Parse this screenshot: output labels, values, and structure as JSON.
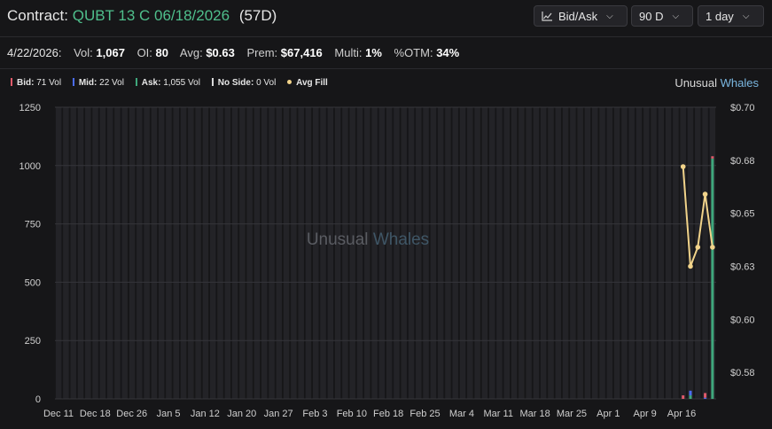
{
  "header": {
    "contract_prefix": "Contract:",
    "contract_name": "QUBT 13 C 06/18/2026",
    "dte": "(57D)",
    "view_label": "Bid/Ask",
    "range_label": "90 D",
    "interval_label": "1 day"
  },
  "stats": {
    "date": "4/22/2026:",
    "vol_label": "Vol:",
    "vol": "1,067",
    "oi_label": "OI:",
    "oi": "80",
    "avg_label": "Avg:",
    "avg": "$0.63",
    "prem_label": "Prem:",
    "prem": "$67,416",
    "multi_label": "Multi:",
    "multi": "1%",
    "otm_label": "%OTM:",
    "otm": "34%"
  },
  "legend": {
    "bid_label": "Bid:",
    "bid_value": "71 Vol",
    "mid_label": "Mid:",
    "mid_value": "22 Vol",
    "ask_label": "Ask:",
    "ask_value": "1,055 Vol",
    "noside_label": "No Side:",
    "noside_value": "0 Vol",
    "avgfill_label": "Avg Fill"
  },
  "brand": {
    "word1": "Unusual",
    "word2": "Whales"
  },
  "colors": {
    "bid": "#e05a6a",
    "mid": "#4a6cf0",
    "ask": "#3fa77c",
    "noside": "#d9d9d9",
    "avgfill": "#f1d38a",
    "background": "#161618"
  },
  "chart_data": {
    "type": "bar",
    "x_tick_labels": [
      "Dec 11",
      "Dec 18",
      "Dec 26",
      "Jan 5",
      "Jan 12",
      "Jan 20",
      "Jan 27",
      "Feb 3",
      "Feb 10",
      "Feb 18",
      "Feb 25",
      "Mar 4",
      "Mar 11",
      "Mar 18",
      "Mar 25",
      "Apr 1",
      "Apr 9",
      "Apr 16"
    ],
    "y_left_ticks": [
      0,
      250,
      500,
      750,
      1000,
      1250
    ],
    "y_left_range": [
      0,
      1250
    ],
    "y_right_tick_labels": [
      "$0.58",
      "$0.60",
      "$0.63",
      "$0.65",
      "$0.68",
      "$0.70"
    ],
    "y_right_tick_values": [
      0.575,
      0.6,
      0.625,
      0.65,
      0.675,
      0.7
    ],
    "y_right_range": [
      0.5625,
      0.7
    ],
    "num_days": 90,
    "series": [
      {
        "name": "Bid",
        "values_by_day": {
          "86": 15,
          "87": 0,
          "88": 0,
          "89": 20,
          "90": 10
        }
      },
      {
        "name": "Mid",
        "values_by_day": {
          "87": 20,
          "88": 0,
          "89": 5,
          "90": 0
        }
      },
      {
        "name": "Ask",
        "values_by_day": {
          "87": 15,
          "88": 0,
          "89": 0,
          "90": 1030
        }
      }
    ],
    "avg_fill": [
      {
        "day": 86,
        "price": 0.672
      },
      {
        "day": 87,
        "price": 0.625
      },
      {
        "day": 88,
        "price": 0.634
      },
      {
        "day": 89,
        "price": 0.659
      },
      {
        "day": 90,
        "price": 0.634
      }
    ],
    "watermark": "Unusual Whales",
    "grid": true
  }
}
